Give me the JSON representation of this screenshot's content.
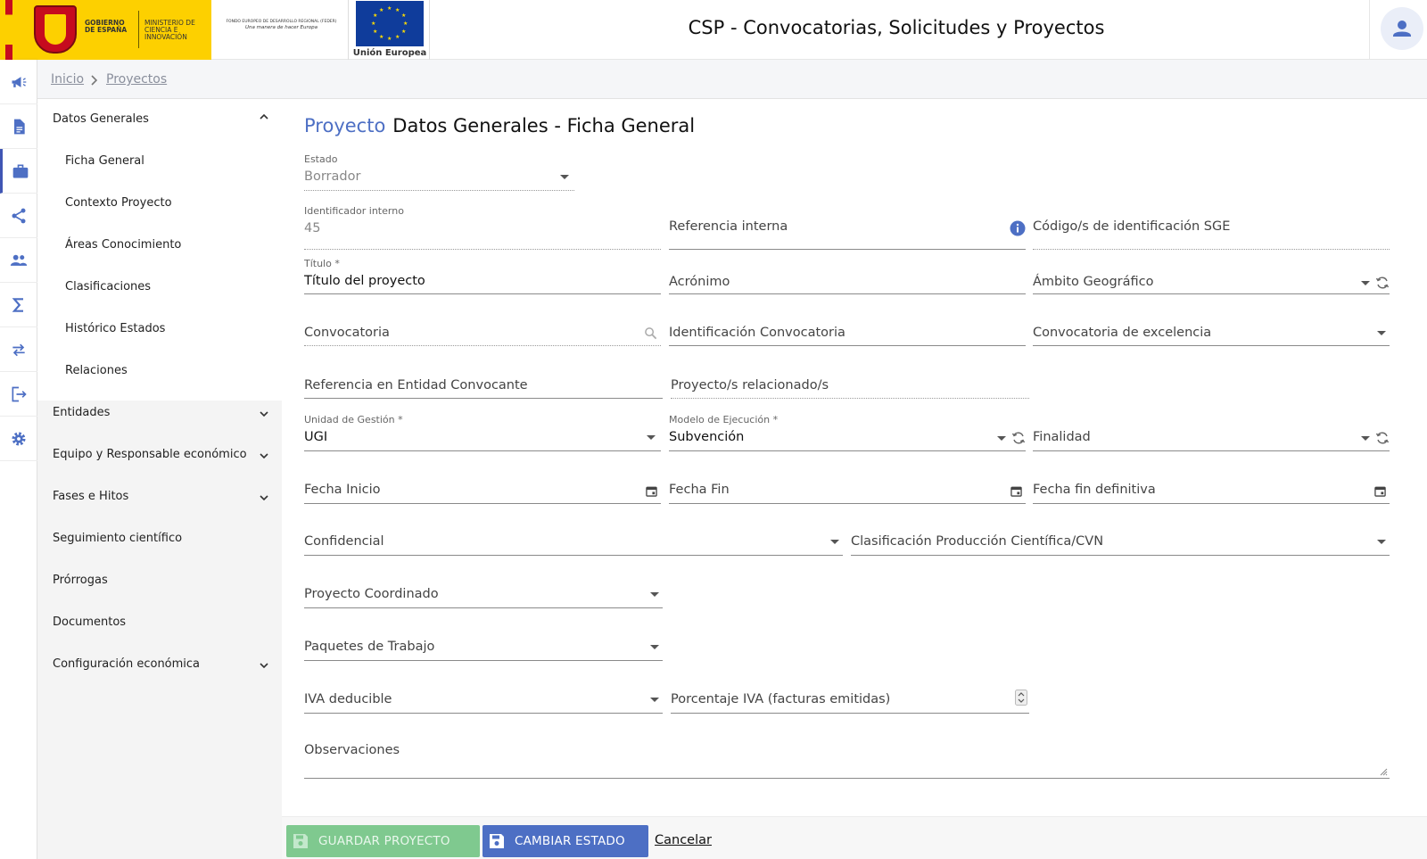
{
  "header": {
    "gov_line1": "GOBIERNO DE ESPAÑA",
    "gov_line2": "MINISTERIO DE CIENCIA E INNOVACIÓN",
    "feder_line": "FONDO EUROPEO DE DESARROLLO REGIONAL (FEDER)",
    "feder_slogan": "Una manera de hacer Europa",
    "eu_label": "Unión Europea",
    "app_title": "CSP - Convocatorias, Solicitudes y Proyectos",
    "user_icon": "user-icon"
  },
  "rail": {
    "items": [
      {
        "icon": "megaphone-icon"
      },
      {
        "icon": "document-icon"
      },
      {
        "icon": "briefcase-icon"
      },
      {
        "icon": "share-icon"
      },
      {
        "icon": "people-icon"
      },
      {
        "icon": "sigma-icon"
      },
      {
        "icon": "swap-icon"
      },
      {
        "icon": "logout-icon"
      },
      {
        "icon": "gear-icon"
      }
    ]
  },
  "breadcrumb": {
    "home": "Inicio",
    "current": "Proyectos"
  },
  "sidemenu": {
    "datos_generales": "Datos Generales",
    "sub": [
      "Ficha General",
      "Contexto Proyecto",
      "Áreas Conocimiento",
      "Clasificaciones",
      "Histórico Estados",
      "Relaciones"
    ],
    "items": [
      "Entidades",
      "Equipo y Responsable económico",
      "Fases e Hitos",
      "Seguimiento científico",
      "Prórrogas",
      "Documentos",
      "Configuración económica"
    ]
  },
  "page": {
    "entity": "Proyecto",
    "section": "Datos Generales - Ficha General"
  },
  "form": {
    "estado_label": "Estado",
    "estado_value": "Borrador",
    "identificador_label": "Identificador interno",
    "identificador_value": "45",
    "referencia_interna": "Referencia interna",
    "codigo_sge": "Código/s de identificación SGE",
    "titulo_label": "Título *",
    "titulo_value": "Título del proyecto",
    "acronimo": "Acrónimo",
    "ambito": "Ámbito Geográfico",
    "convocatoria": "Convocatoria",
    "identificacion_convocatoria": "Identificación Convocatoria",
    "convocatoria_excelencia": "Convocatoria de excelencia",
    "referencia_entidad": "Referencia en Entidad Convocante",
    "proyectos_relacionados": "Proyecto/s relacionado/s",
    "unidad_label": "Unidad de Gestión *",
    "unidad_value": "UGI",
    "modelo_label": "Modelo de Ejecución *",
    "modelo_value": "Subvención",
    "finalidad": "Finalidad",
    "fecha_inicio": "Fecha Inicio",
    "fecha_fin": "Fecha Fin",
    "fecha_fin_definitiva": "Fecha fin definitiva",
    "confidencial": "Confidencial",
    "clasificacion_cvn": "Clasificación Producción Científica/CVN",
    "proyecto_coordinado": "Proyecto Coordinado",
    "paquetes_trabajo": "Paquetes de Trabajo",
    "iva_deducible": "IVA deducible",
    "porcentaje_iva": "Porcentaje IVA (facturas emitidas)",
    "observaciones": "Observaciones"
  },
  "actions": {
    "save": "GUARDAR PROYECTO",
    "change_state": "CAMBIAR ESTADO",
    "cancel": "Cancelar"
  },
  "colors": {
    "accent": "#4d6fc4",
    "save_button": "#7fc98f",
    "gov_yellow": "#fdd000",
    "eu_blue": "#0f3c9b"
  }
}
